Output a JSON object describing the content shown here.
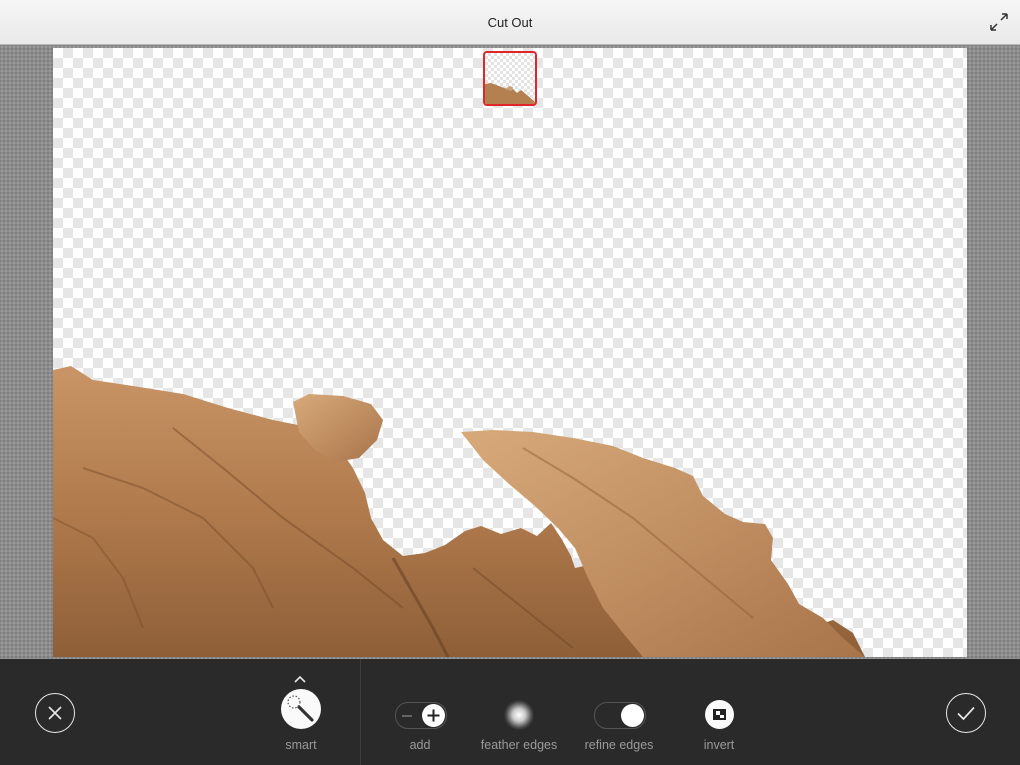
{
  "header": {
    "title": "Cut Out",
    "expand_icon": "expand-arrows-icon"
  },
  "canvas": {
    "background": "transparency-checkerboard",
    "subject": "rock cutout",
    "thumbnail_border_color": "#e0262b"
  },
  "toolbar": {
    "cancel_icon": "close-icon",
    "confirm_icon": "checkmark-icon",
    "tools": {
      "smart": {
        "label": "smart",
        "icon": "magic-wand-icon",
        "expand_icon": "chevron-up-icon"
      },
      "add": {
        "label": "add",
        "state": "add"
      },
      "feather": {
        "label": "feather edges",
        "icon": "soft-brush-icon"
      },
      "refine": {
        "label": "refine edges",
        "state": "on"
      },
      "invert": {
        "label": "invert",
        "icon": "invert-mask-icon"
      }
    }
  }
}
